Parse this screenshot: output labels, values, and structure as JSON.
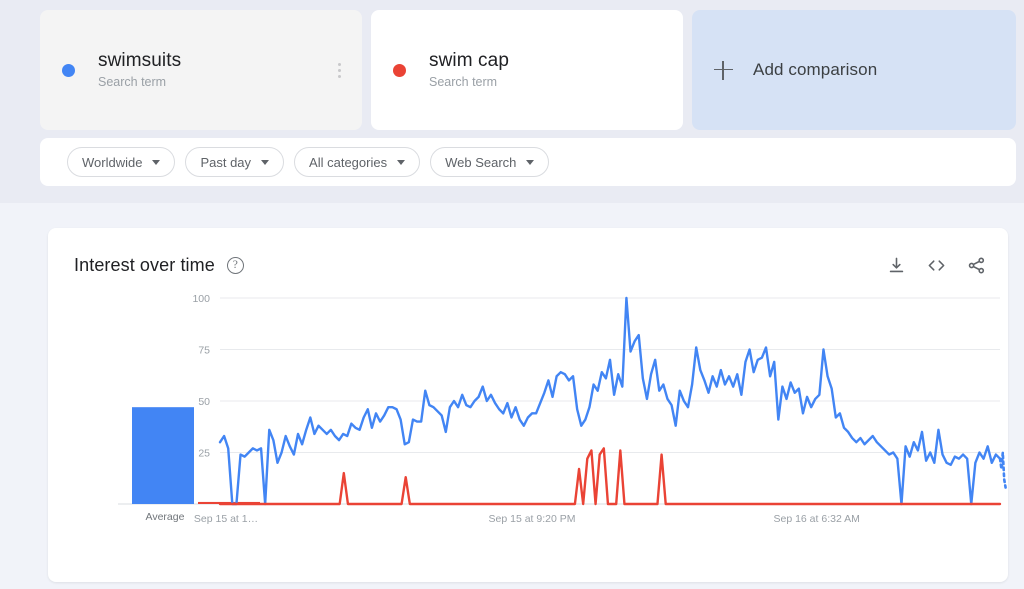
{
  "terms": [
    {
      "name": "swimsuits",
      "subtitle": "Search term",
      "color": "#4285F4",
      "menu_icon": "more-vert-icon"
    },
    {
      "name": "swim cap",
      "subtitle": "Search term",
      "color": "#EA4335"
    }
  ],
  "add_comparison": {
    "label": "Add comparison",
    "icon": "plus-icon"
  },
  "filters": [
    {
      "label": "Worldwide",
      "icon": "chevron-down-icon"
    },
    {
      "label": "Past day",
      "icon": "chevron-down-icon"
    },
    {
      "label": "All categories",
      "icon": "chevron-down-icon"
    },
    {
      "label": "Web Search",
      "icon": "chevron-down-icon"
    }
  ],
  "chart_card": {
    "title": "Interest over time",
    "help_icon": "help-circle-icon",
    "help_glyph": "?",
    "actions": [
      {
        "name": "download-icon",
        "label": "Download"
      },
      {
        "name": "embed-code-icon",
        "label": "Embed"
      },
      {
        "name": "share-icon",
        "label": "Share"
      }
    ]
  },
  "chart_data": {
    "type": "line",
    "title": "Interest over time",
    "xlabel": "",
    "ylabel": "",
    "ylim": [
      0,
      100
    ],
    "yticks": [
      100,
      75,
      50,
      25
    ],
    "grid": true,
    "legend": "cards",
    "xticks": [
      {
        "label": "Sep 15 at 1…",
        "pos": 0.03
      },
      {
        "label": "Sep 15 at 9:20 PM",
        "pos": 0.4
      },
      {
        "label": "Sep 16 at 6:32 AM",
        "pos": 0.765
      }
    ],
    "average_panel": {
      "label": "Average",
      "values": [
        {
          "name": "swimsuits",
          "value": 47,
          "color": "#4285F4"
        },
        {
          "name": "swim cap",
          "value": 1,
          "color": "#EA4335"
        }
      ]
    },
    "partial_tail": true,
    "series": [
      {
        "name": "swimsuits",
        "color": "#4285F4",
        "values": [
          30,
          33,
          27,
          0,
          0,
          24,
          23,
          25,
          27,
          26,
          27,
          0,
          36,
          31,
          20,
          25,
          33,
          28,
          24,
          34,
          29,
          36,
          42,
          34,
          38,
          36,
          34,
          36,
          33,
          31,
          34,
          33,
          39,
          37,
          36,
          42,
          46,
          37,
          44,
          40,
          43,
          47,
          47,
          46,
          41,
          29,
          30,
          41,
          40,
          40,
          55,
          48,
          47,
          45,
          43,
          35,
          47,
          50,
          47,
          53,
          48,
          47,
          50,
          52,
          57,
          50,
          53,
          49,
          46,
          44,
          49,
          42,
          47,
          41,
          38,
          42,
          44,
          44,
          49,
          54,
          60,
          52,
          62,
          64,
          63,
          60,
          62,
          46,
          38,
          41,
          47,
          58,
          55,
          64,
          61,
          70,
          53,
          63,
          57,
          100,
          74,
          79,
          82,
          61,
          51,
          63,
          70,
          55,
          58,
          51,
          48,
          38,
          55,
          50,
          47,
          58,
          76,
          65,
          60,
          54,
          62,
          57,
          65,
          58,
          62,
          57,
          63,
          53,
          69,
          75,
          64,
          70,
          71,
          76,
          62,
          69,
          41,
          57,
          51,
          59,
          54,
          56,
          44,
          52,
          47,
          51,
          53,
          75,
          62,
          56,
          42,
          44,
          37,
          35,
          32,
          30,
          32,
          29,
          31,
          33,
          30,
          28,
          26,
          24,
          25,
          22,
          0,
          28,
          23,
          30,
          26,
          35,
          21,
          25,
          20,
          36,
          24,
          20,
          19,
          23,
          22,
          24,
          22,
          0,
          20,
          25,
          22,
          28,
          20,
          24,
          22
        ],
        "tail_dotted_values": [
          17,
          25,
          12,
          8
        ]
      },
      {
        "name": "swim cap",
        "color": "#EA4335",
        "values": [
          0,
          0,
          0,
          0,
          0,
          0,
          0,
          0,
          0,
          0,
          0,
          0,
          0,
          0,
          0,
          0,
          0,
          0,
          0,
          0,
          0,
          0,
          0,
          0,
          0,
          0,
          0,
          0,
          0,
          0,
          15,
          0,
          0,
          0,
          0,
          0,
          0,
          0,
          0,
          0,
          0,
          0,
          0,
          0,
          0,
          13,
          0,
          0,
          0,
          0,
          0,
          0,
          0,
          0,
          0,
          0,
          0,
          0,
          0,
          0,
          0,
          0,
          0,
          0,
          0,
          0,
          0,
          0,
          0,
          0,
          0,
          0,
          0,
          0,
          0,
          0,
          0,
          0,
          0,
          0,
          0,
          0,
          0,
          0,
          0,
          0,
          0,
          17,
          0,
          22,
          26,
          0,
          24,
          27,
          0,
          0,
          0,
          26,
          0,
          0,
          0,
          0,
          0,
          0,
          0,
          0,
          0,
          24,
          0,
          0,
          0,
          0,
          0,
          0,
          0,
          0,
          0,
          0,
          0,
          0,
          0,
          0,
          0,
          0,
          0,
          0,
          0,
          0,
          0,
          0,
          0,
          0,
          0,
          0,
          0,
          0,
          0,
          0,
          0,
          0,
          0,
          0,
          0,
          0,
          0,
          0,
          0,
          0,
          0,
          0,
          0,
          0,
          0,
          0,
          0,
          0,
          0,
          0,
          0,
          0,
          0,
          0,
          0,
          0,
          0,
          0,
          0,
          0,
          0,
          0,
          0,
          0,
          0,
          0,
          0,
          0,
          0,
          0,
          0,
          0,
          0,
          0,
          0,
          0,
          0,
          0,
          0,
          0,
          0,
          0
        ]
      }
    ]
  }
}
